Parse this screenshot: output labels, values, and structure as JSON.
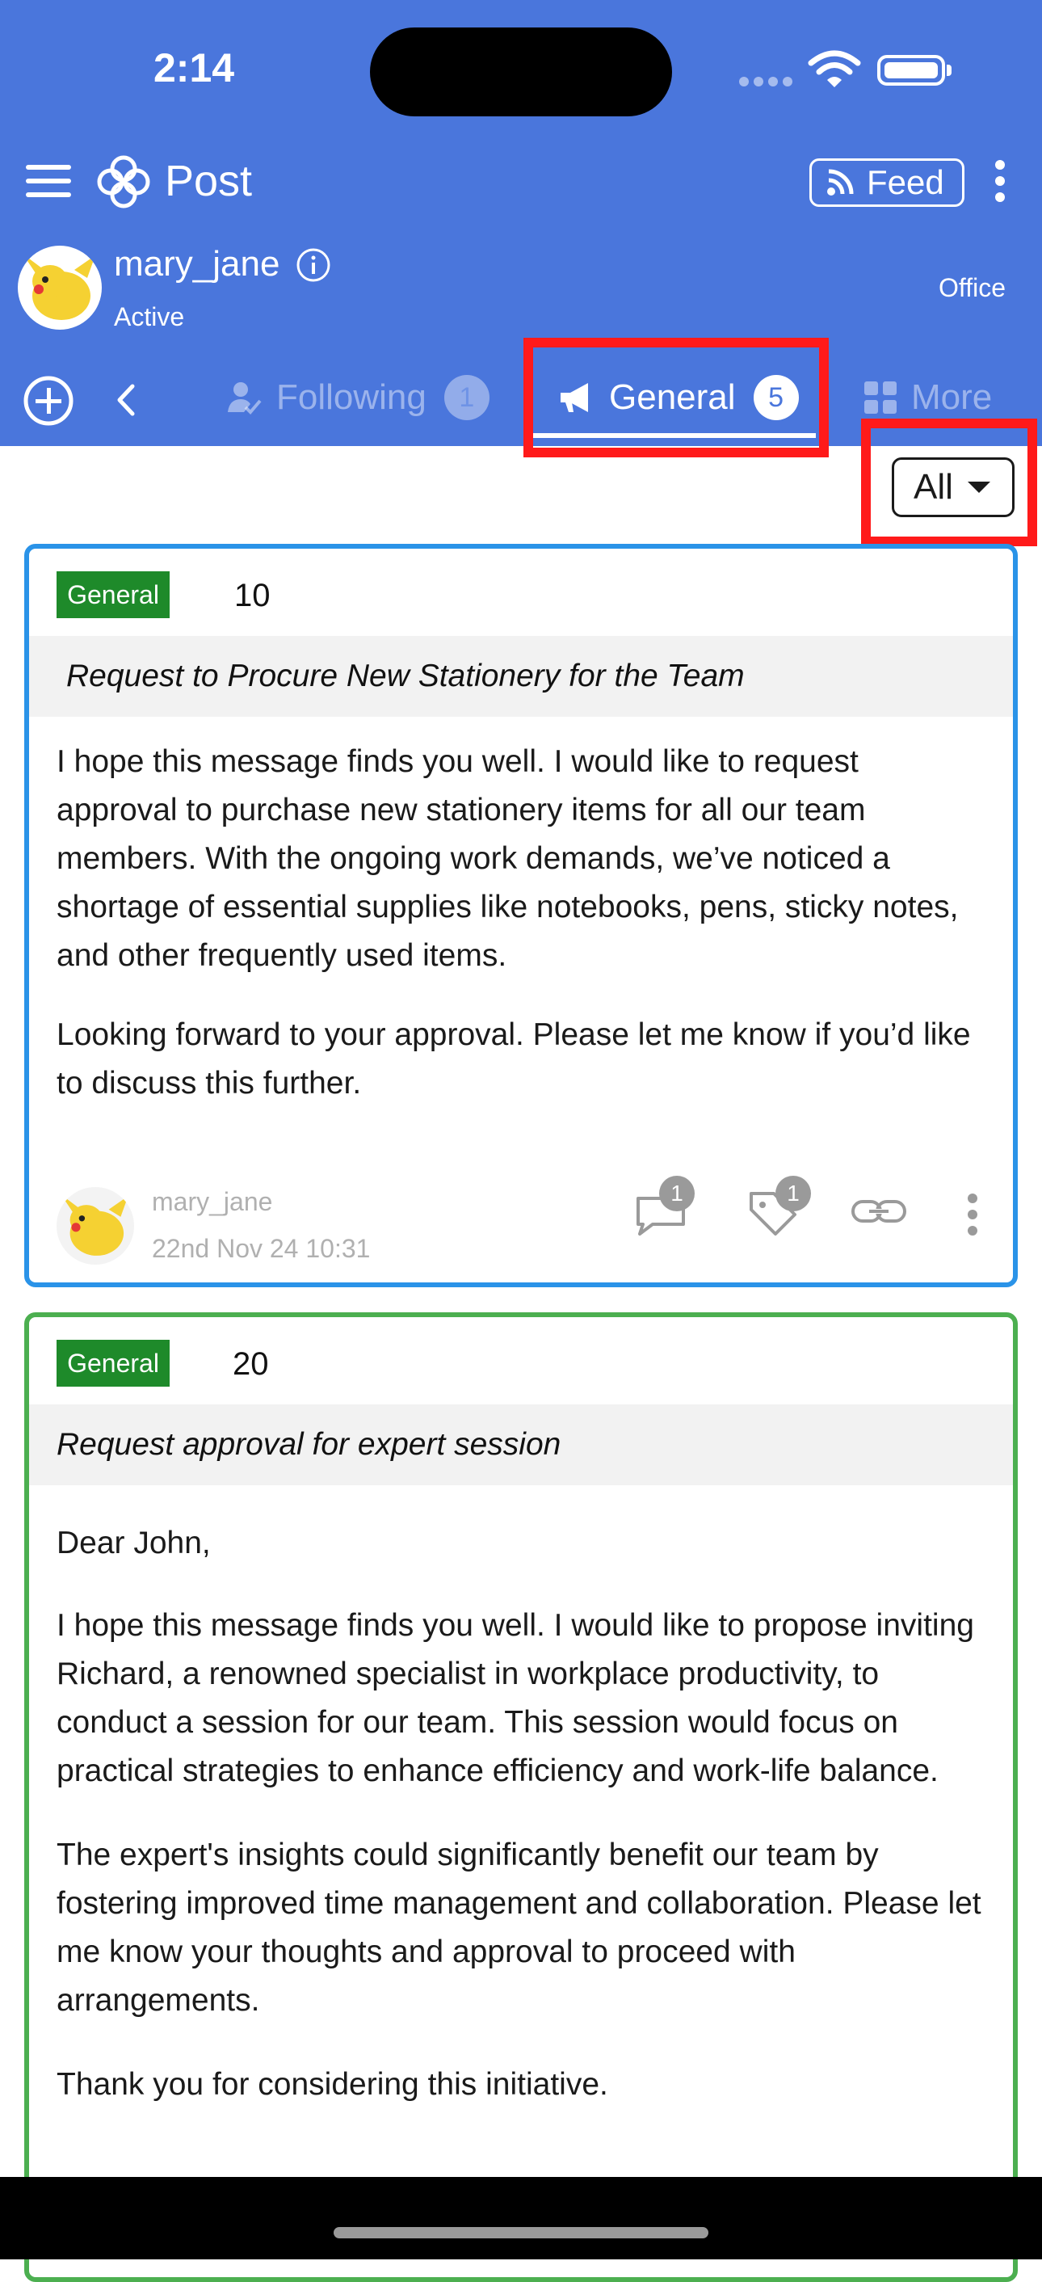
{
  "status_bar": {
    "time": "2:14"
  },
  "app": {
    "title": "Post",
    "feed_label": "Feed"
  },
  "user": {
    "name": "mary_jane",
    "status": "Active",
    "location": "Office"
  },
  "tabs": [
    {
      "label": "Following",
      "count": "1",
      "icon": "user-check-icon"
    },
    {
      "label": "General",
      "count": "5",
      "icon": "megaphone-icon",
      "active": true
    },
    {
      "label": "More",
      "icon": "grid-icon"
    }
  ],
  "filter": {
    "value": "All"
  },
  "colors": {
    "header": "#4a76dc",
    "highlight": "#ff1a1a",
    "category": "#1e8a2a",
    "card1_border": "#2a93e8",
    "card2_border": "#4caf50"
  },
  "posts": [
    {
      "category": "General",
      "number": "10",
      "subject": "Request to Procure New Stationery for the Team",
      "paragraphs": [
        "I hope this message finds you well. I would like to request approval to purchase new stationery items for all our team members. With the ongoing work demands, we’ve noticed a shortage of essential supplies like notebooks, pens, sticky notes, and other frequently used items.",
        "Looking forward to your approval. Please let me know if you’d like to discuss this further."
      ],
      "author": "mary_jane",
      "date": "22nd Nov 24 10:31",
      "comments": "1",
      "tags": "1"
    },
    {
      "category": "General",
      "number": "20",
      "subject": "Request approval for expert session",
      "paragraphs": [
        "Dear John,",
        "I hope this message finds you well. I would like to propose inviting Richard, a renowned specialist in workplace productivity, to conduct a session for our team. This session would focus on practical strategies to enhance efficiency and work-life balance.",
        "The expert's insights could significantly benefit our team by fostering improved time management and collaboration. Please let me know your thoughts and approval to proceed with arrangements.",
        "Thank you for considering this initiative."
      ]
    }
  ]
}
